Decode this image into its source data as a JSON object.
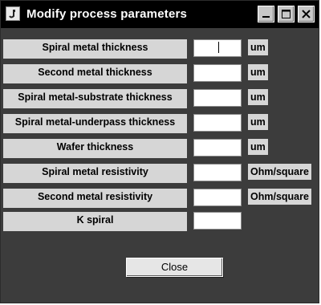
{
  "window": {
    "title": "Modify process parameters"
  },
  "titlebar_buttons": {
    "minimize": "minimize-icon",
    "maximize": "maximize-icon",
    "close": "close-icon"
  },
  "parameters": [
    {
      "label": "Spiral metal thickness",
      "value": "",
      "unit": "um"
    },
    {
      "label": "Second metal thickness",
      "value": "",
      "unit": "um"
    },
    {
      "label": "Spiral metal-substrate thickness",
      "value": "",
      "unit": "um"
    },
    {
      "label": "Spiral metal-underpass thickness",
      "value": "",
      "unit": "um"
    },
    {
      "label": "Wafer thickness",
      "value": "",
      "unit": "um"
    },
    {
      "label": "Spiral metal resistivity",
      "value": "",
      "unit": "Ohm/square"
    },
    {
      "label": "Second metal resistivity",
      "value": "",
      "unit": "Ohm/square"
    },
    {
      "label": "K spiral",
      "value": "",
      "unit": ""
    }
  ],
  "actions": {
    "close_label": "Close"
  },
  "colors": {
    "titlebar": "#000000",
    "window_bg": "#3c3c3c",
    "label_bg": "#d6d6d6",
    "input_bg": "#ffffff"
  }
}
